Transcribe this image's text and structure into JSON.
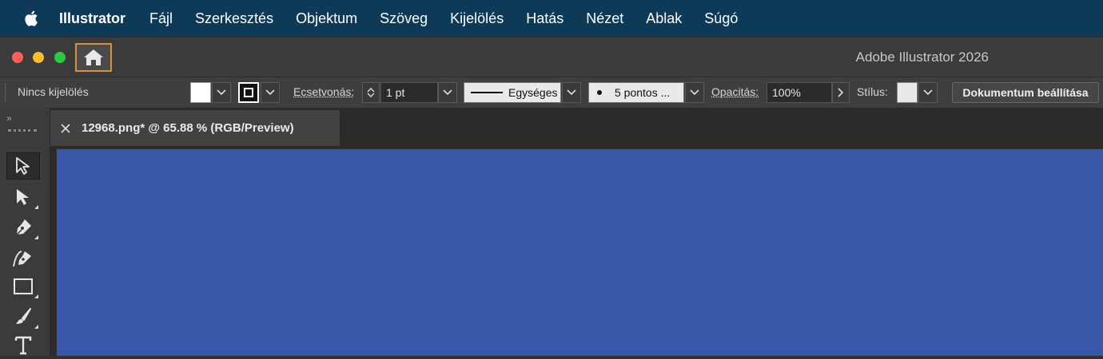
{
  "menubar": {
    "apple_icon": "apple-logo-icon",
    "items": [
      "Illustrator",
      "Fájl",
      "Szerkesztés",
      "Objektum",
      "Szöveg",
      "Kijelölés",
      "Hatás",
      "Nézet",
      "Ablak",
      "Súgó"
    ]
  },
  "window": {
    "title": "Adobe Illustrator 2026",
    "home_icon": "home-icon",
    "colors": {
      "close": "#ff5f57",
      "minimize": "#febc2e",
      "zoom": "#28c840",
      "home_highlight": "#d5913b"
    }
  },
  "control_bar": {
    "selection": "Nincs kijelölés",
    "stroke_label": "Ecsetvonás:",
    "stroke_weight": "1 pt",
    "profile": "Egységes",
    "brush": "5 pontos ...",
    "opacity_label": "Opacitás:",
    "opacity_value": "100%",
    "style_label": "Stílus:",
    "doc_settings": "Dokumentum beállítása"
  },
  "document": {
    "tab_title": "12968.png* @ 65.88 % (RGB/Preview)",
    "artboard_color": "#3757a8"
  },
  "tools": [
    "selection-tool",
    "direct-selection-tool",
    "pen-tool",
    "curvature-tool",
    "rectangle-tool",
    "paintbrush-tool",
    "type-tool"
  ]
}
